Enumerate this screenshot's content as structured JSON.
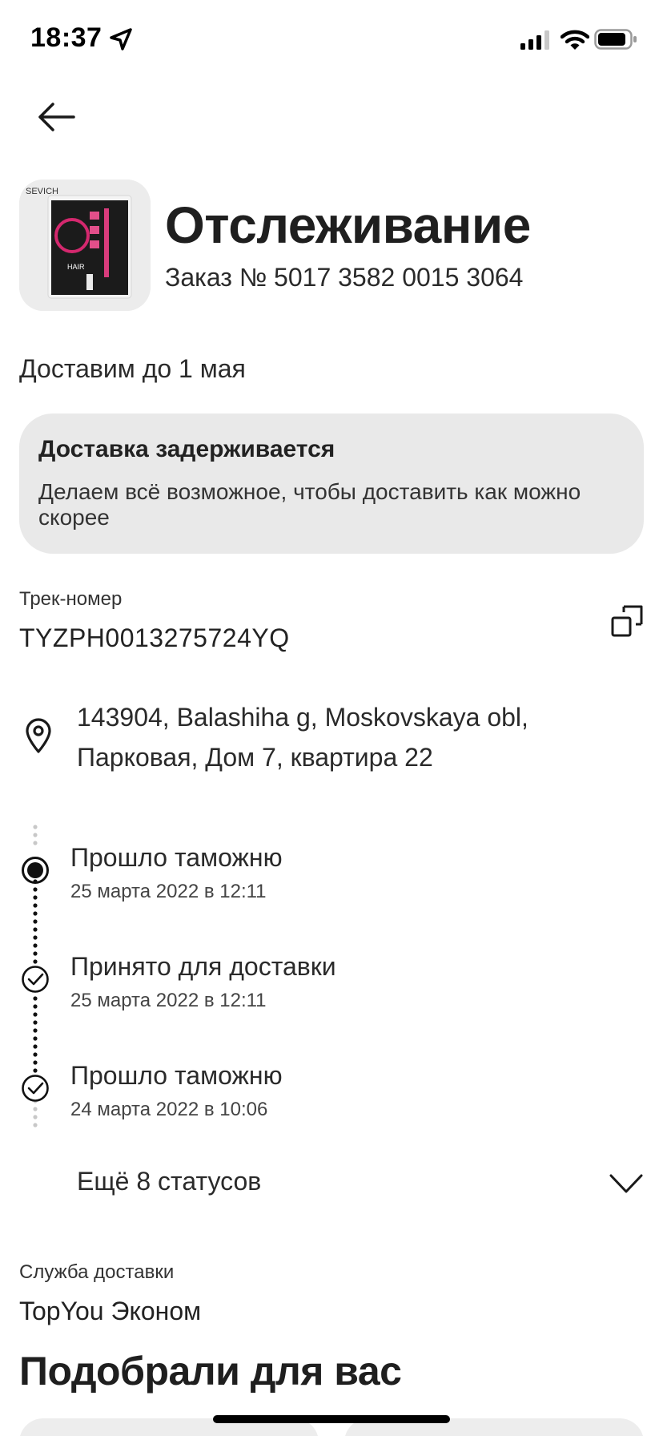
{
  "status_bar": {
    "time": "18:37"
  },
  "header": {
    "title": "Отслеживание",
    "order_number": "Заказ № 5017 3582 0015 3064",
    "product_brand": "SEVICH",
    "product_text": "HAIR"
  },
  "delivery": {
    "eta": "Доставим до 1 мая"
  },
  "delay_notice": {
    "title": "Доставка задерживается",
    "text": "Делаем всё возможное, чтобы доставить как можно скорее"
  },
  "tracking": {
    "label": "Трек-номер",
    "value": "TYZPH0013275724YQ"
  },
  "address": {
    "line1": "143904, Balashiha g, Moskovskaya obl,",
    "line2": "Парковая, Дом 7, квартира 22"
  },
  "timeline": [
    {
      "title": "Прошло таможню",
      "date": "25 марта 2022 в 12:11",
      "state": "current"
    },
    {
      "title": "Принято для доставки",
      "date": "25 марта 2022 в 12:11",
      "state": "done"
    },
    {
      "title": "Прошло таможню",
      "date": "24 марта 2022 в 10:06",
      "state": "done"
    }
  ],
  "more_statuses": {
    "label": "Ещё 8 статусов"
  },
  "delivery_service": {
    "label": "Служба доставки",
    "value": "TopYou Эконом"
  },
  "recommendations": {
    "title": "Подобрали для вас"
  },
  "colors": {
    "background": "#ffffff",
    "card": "#e9e9e9",
    "text": "#1f1f1f"
  }
}
